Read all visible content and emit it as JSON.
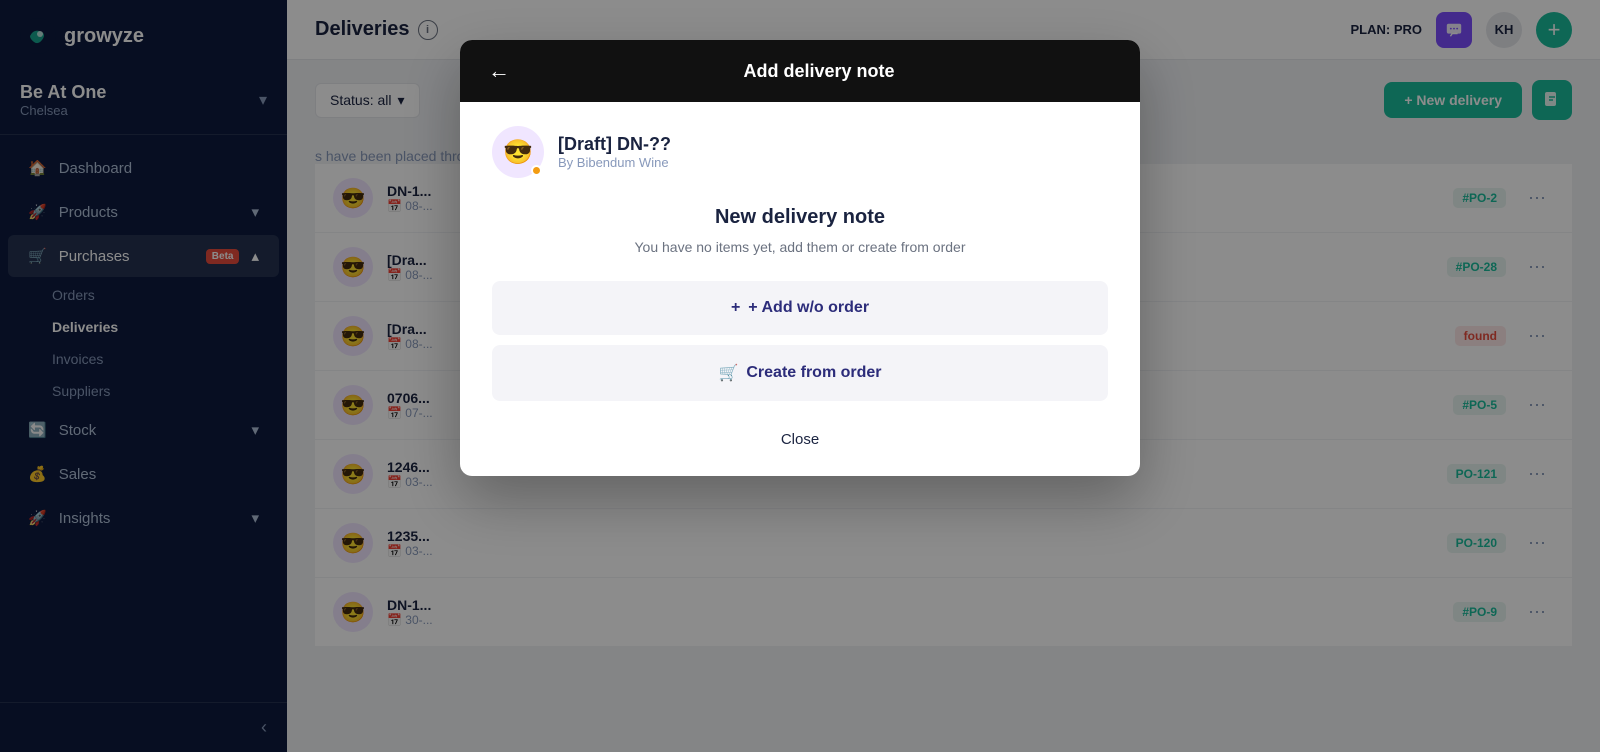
{
  "sidebar": {
    "logo_text": "growyze",
    "venue": {
      "name": "Be At One",
      "location": "Chelsea",
      "chevron": "▾"
    },
    "nav_items": [
      {
        "id": "dashboard",
        "label": "Dashboard",
        "icon": "🏠",
        "active": false
      },
      {
        "id": "products",
        "label": "Products",
        "icon": "🚀",
        "active": false,
        "has_chevron": true
      },
      {
        "id": "purchases",
        "label": "Purchases",
        "icon": "🛒",
        "active": true,
        "badge": "Beta",
        "has_chevron": true
      },
      {
        "id": "stock",
        "label": "Stock",
        "icon": "🔄",
        "active": false,
        "has_chevron": true
      },
      {
        "id": "sales",
        "label": "Sales",
        "icon": "💰",
        "active": false
      },
      {
        "id": "insights",
        "label": "Insights",
        "icon": "🚀",
        "active": false,
        "has_chevron": true
      }
    ],
    "sub_items": [
      {
        "id": "orders",
        "label": "Orders",
        "active": false
      },
      {
        "id": "deliveries",
        "label": "Deliveries",
        "active": true
      },
      {
        "id": "invoices",
        "label": "Invoices",
        "active": false
      },
      {
        "id": "suppliers",
        "label": "Suppliers",
        "active": false
      }
    ],
    "collapse_icon": "‹"
  },
  "topbar": {
    "title": "Deliveries",
    "plan_label": "PLAN: PRO",
    "avatar_initials": "KH",
    "add_icon": "+"
  },
  "filter_bar": {
    "status_label": "Status: all",
    "new_delivery_label": "+ New delivery"
  },
  "deliveries": [
    {
      "id": "DN-1",
      "name": "DN-1",
      "date": "08-...",
      "po": "#PO-2",
      "status": ""
    },
    {
      "id": "Draft1",
      "name": "[Dra...",
      "date": "08-...",
      "po": "#PO-28",
      "status": ""
    },
    {
      "id": "Draft2",
      "name": "[Dra...",
      "date": "08-...",
      "po": "",
      "status": "found"
    },
    {
      "id": "0706",
      "name": "0706...",
      "date": "07-...",
      "po": "#PO-5",
      "status": ""
    },
    {
      "id": "1246",
      "name": "1246...",
      "date": "03-...",
      "po": "PO-121",
      "status": ""
    },
    {
      "id": "1235",
      "name": "1235...",
      "date": "03-...",
      "po": "PO-120",
      "status": ""
    },
    {
      "id": "DN-last",
      "name": "DN-1...",
      "date": "30-...",
      "po": "#PO-9",
      "status": ""
    }
  ],
  "empty_hint": "s have been placed through Growyze",
  "modal": {
    "title": "Add delivery note",
    "back_icon": "←",
    "supplier_name": "[Draft] DN-??",
    "supplier_by": "By Bibendum Wine",
    "supplier_emoji": "😎",
    "section_title": "New delivery note",
    "section_sub": "You have no items yet, add them or create from order",
    "btn_add_label": "+ Add w/o order",
    "btn_create_label": "Create from order",
    "cart_icon": "🛒",
    "close_label": "Close"
  }
}
